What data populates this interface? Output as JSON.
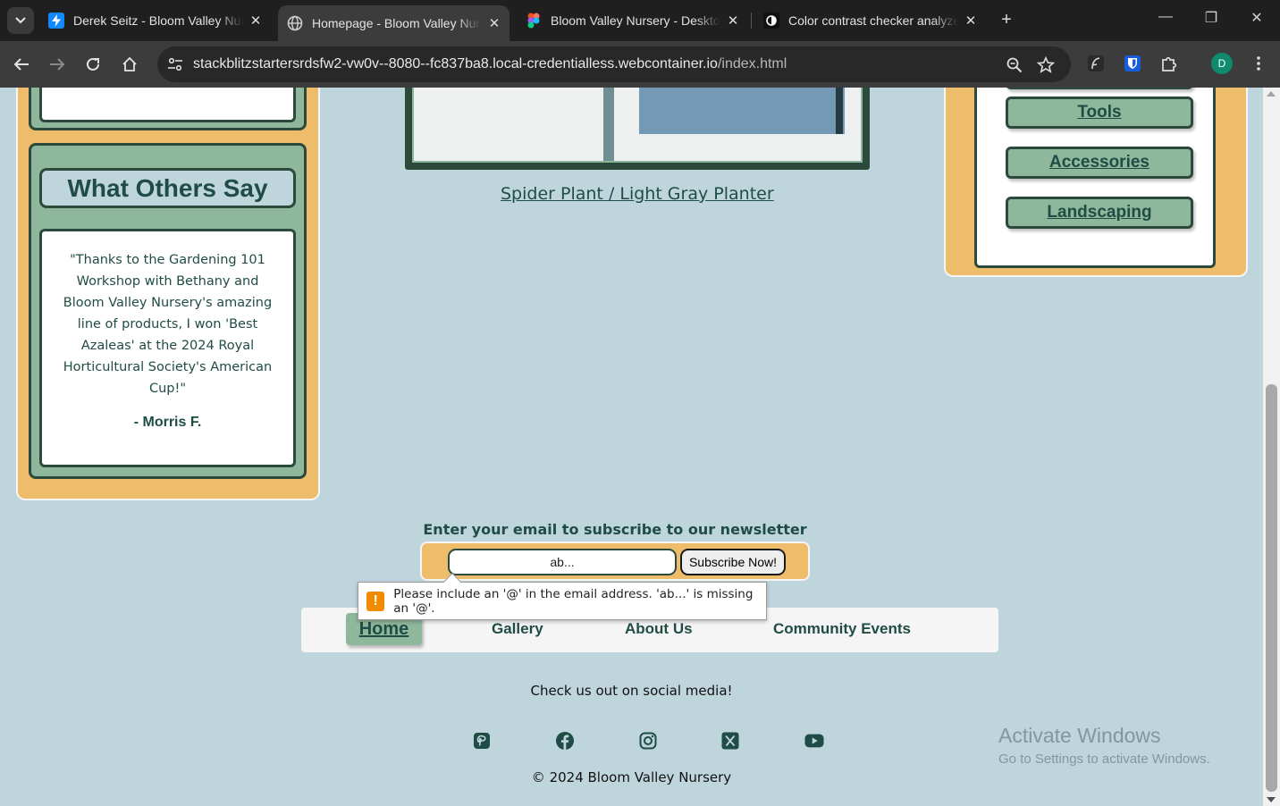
{
  "browser": {
    "tabs": [
      {
        "title": "Derek Seitz - Bloom Valley Nurs",
        "icon": "stackblitz-bolt-icon",
        "active": false
      },
      {
        "title": "Homepage - Bloom Valley Nurs",
        "icon": "globe-icon",
        "active": true
      },
      {
        "title": "Bloom Valley Nursery - Desktop",
        "icon": "figma-icon",
        "active": false
      },
      {
        "title": "Color contrast checker analyzer",
        "icon": "contrast-icon",
        "active": false
      }
    ],
    "url_host": "stackblitzstartersrdsfw2-vw0v--8080--fc837ba8.local-credentialless.webcontainer.io",
    "url_path": "/index.html",
    "profile_initial": "D"
  },
  "testimonials": {
    "title": "What Others Say",
    "quote": "\"Thanks to the Gardening 101 Workshop with Bethany and Bloom Valley Nursery's amazing line of products, I won 'Best Azaleas' at the 2024 Royal Horticultural Society's American Cup!\"",
    "author": "- Morris F."
  },
  "featured": {
    "caption": "Spider Plant / Light Gray Planter"
  },
  "categories": [
    {
      "label": "Tools"
    },
    {
      "label": "Accessories"
    },
    {
      "label": "Landscaping"
    }
  ],
  "newsletter": {
    "label": "Enter your email to subscribe to our newsletter",
    "email_value": "ab...",
    "button": "Subscribe Now!",
    "validation_message": "Please include an '@' in the email address. 'ab...' is missing an '@'."
  },
  "footer": {
    "nav": [
      "Home",
      "Gallery",
      "About Us",
      "Community Events"
    ],
    "social_label": "Check us out on social media!",
    "social_icons": [
      "pinterest-icon",
      "facebook-icon",
      "instagram-icon",
      "x-icon",
      "youtube-icon"
    ],
    "copyright": "© 2024 Bloom Valley Nursery"
  },
  "watermark": {
    "line1": "Activate Windows",
    "line2": "Go to Settings to activate Windows."
  },
  "colors": {
    "page_bg": "#bfd5dc",
    "panel_orange": "#edbd6c",
    "green": "#8fb79c",
    "dark_green": "#2c4a3b",
    "text_green": "#1f4c44"
  }
}
